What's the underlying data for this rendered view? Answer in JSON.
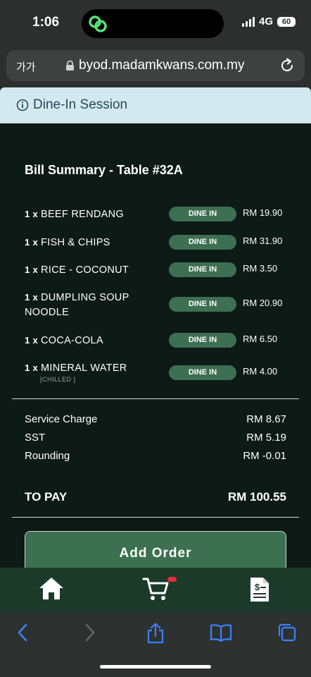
{
  "status": {
    "time": "1:06",
    "network": "4G",
    "battery": "60"
  },
  "browser": {
    "aa_label": "가가",
    "url": "byod.madamkwans.com.my"
  },
  "banner": {
    "text": "Dine-In Session"
  },
  "bill": {
    "title": "Bill Summary - Table #32A",
    "items": [
      {
        "qty": "1 x",
        "name": "BEEF RENDANG",
        "note": "",
        "tag": "DINE IN",
        "price": "RM 19.90"
      },
      {
        "qty": "1 x",
        "name": "FISH & CHIPS",
        "note": "",
        "tag": "DINE IN",
        "price": "RM 31.90"
      },
      {
        "qty": "1 x",
        "name": "RICE - COCONUT",
        "note": "",
        "tag": "DINE IN",
        "price": "RM 3.50"
      },
      {
        "qty": "1 x",
        "name": "DUMPLING SOUP NOODLE",
        "note": "",
        "tag": "DINE IN",
        "price": "RM 20.90"
      },
      {
        "qty": "1 x",
        "name": "COCA-COLA",
        "note": "",
        "tag": "DINE IN",
        "price": "RM 6.50"
      },
      {
        "qty": "1 x",
        "name": "MINERAL WATER",
        "note": "[CHILLED ]",
        "tag": "DINE IN",
        "price": "RM 4.00"
      }
    ],
    "service_charge": {
      "label": "Service Charge",
      "value": "RM 8.67"
    },
    "sst": {
      "label": "SST",
      "value": "RM 5.19"
    },
    "rounding": {
      "label": "Rounding",
      "value": "RM -0.01"
    },
    "to_pay": {
      "label": "TO PAY",
      "value": "RM 100.55"
    },
    "add_order_label": "Add Order"
  },
  "app_nav": {
    "icons": [
      "home-icon",
      "cart-icon",
      "bill-icon"
    ],
    "cart_has_items": true
  },
  "safari_toolbar": {
    "icons": [
      "back-icon",
      "forward-icon",
      "share-icon",
      "bookmarks-icon",
      "tabs-icon"
    ]
  },
  "colors": {
    "background": "#0d1a16",
    "banner_bg": "#d4e9ef",
    "pill": "#3d6f52",
    "button": "#3c7050",
    "nav_bg": "#1c3a2a",
    "badge": "#e0303a",
    "safari_blue": "#3b82f6"
  }
}
